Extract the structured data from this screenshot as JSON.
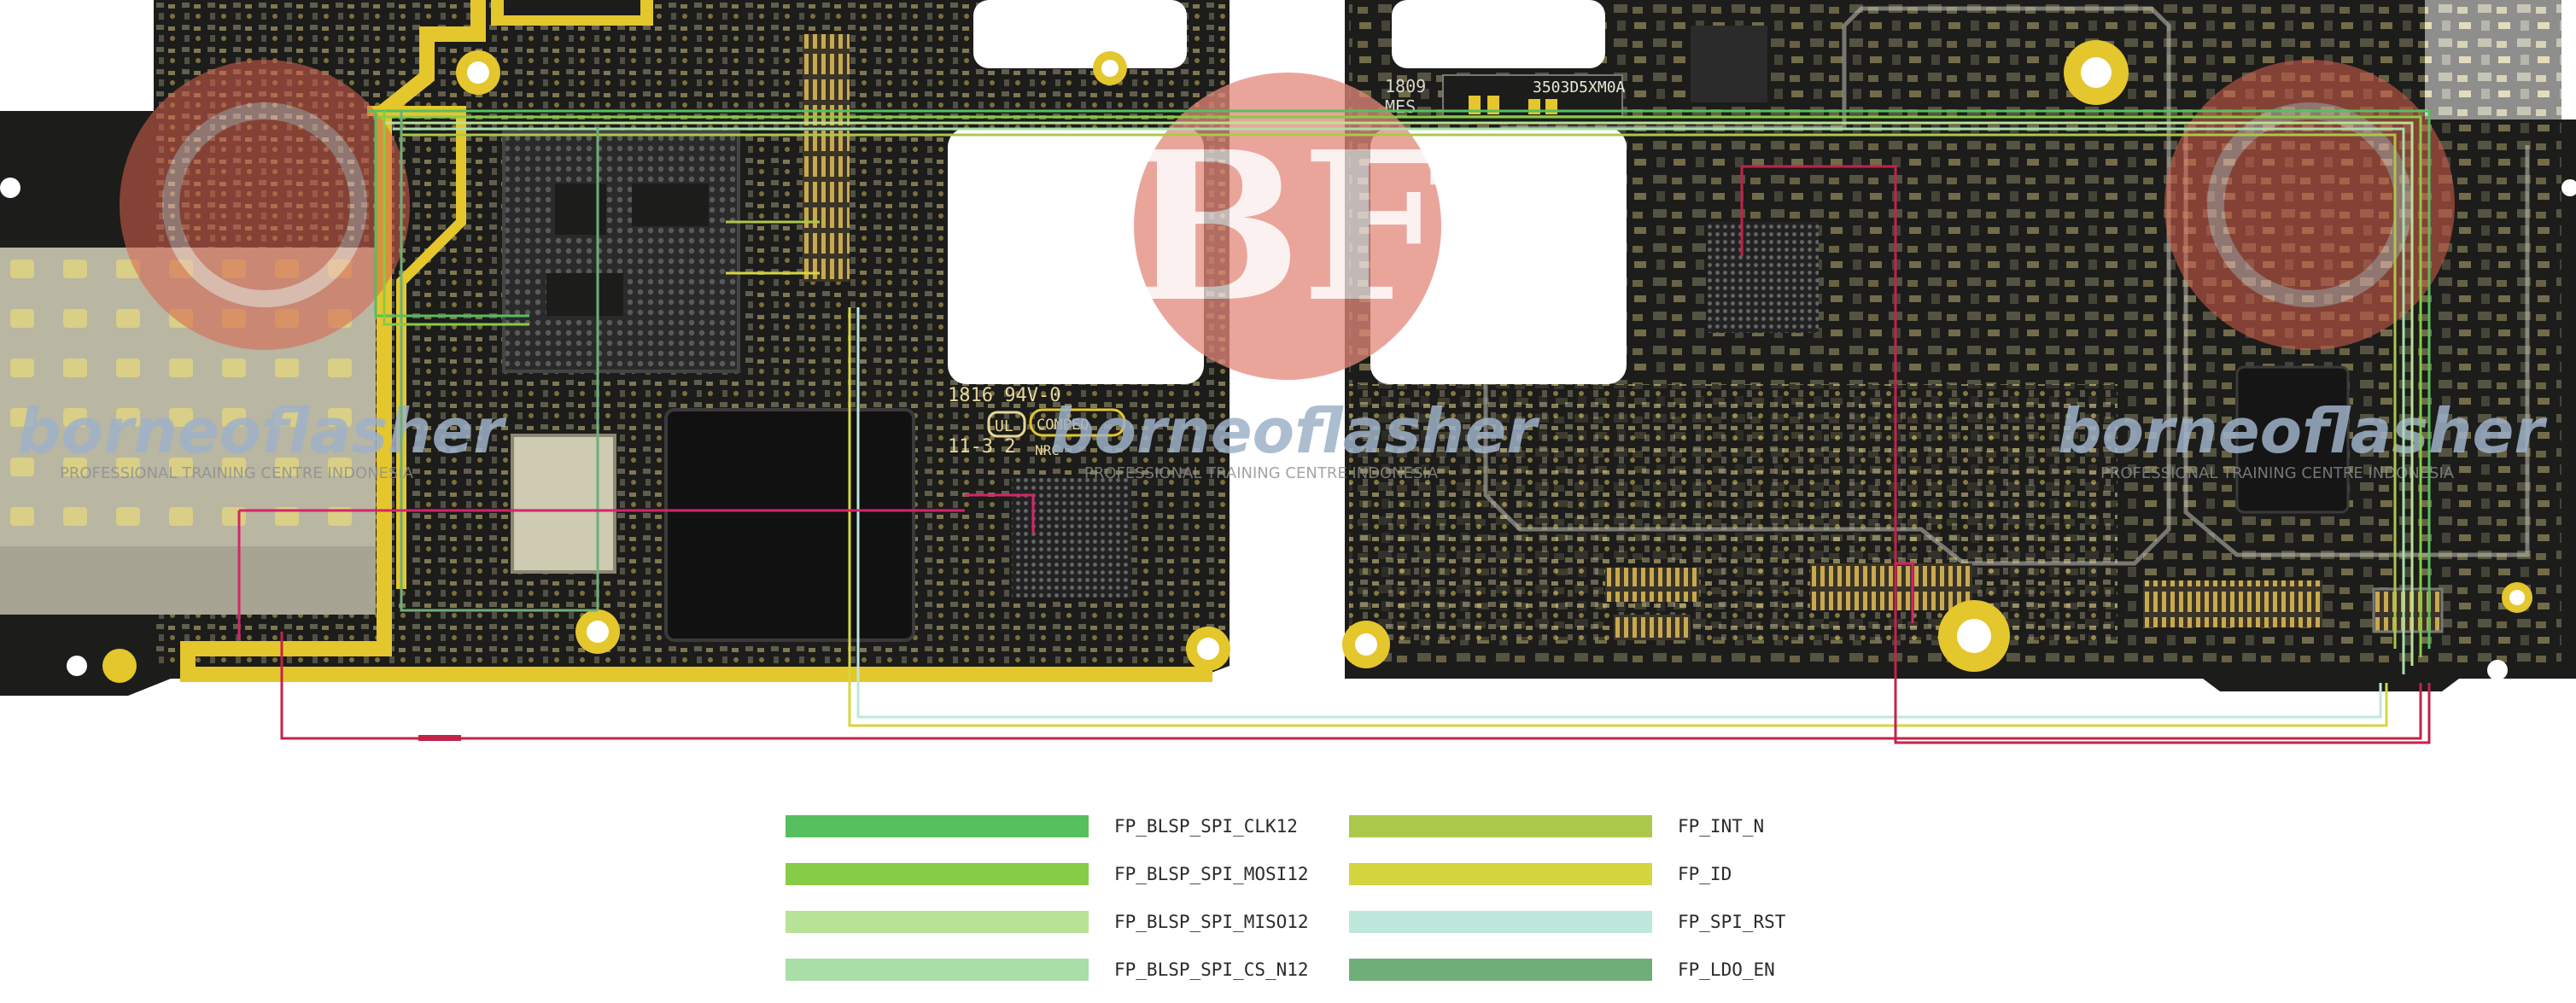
{
  "watermark": {
    "brand": "borneoflasher",
    "tagline": "PROFESSIONAL TRAINING CENTRE INDONESIA",
    "logo_text": "BF"
  },
  "silkscreen": {
    "date_code_line1": "1816 94V-0",
    "date_code_line2": "11-3 2",
    "ul_text": "UL",
    "compeq": "COMPEQ",
    "nrc": "NRC",
    "board_id_left": "1809",
    "board_id_left2": "MES",
    "board_id_right": "3503D5XM0A"
  },
  "legend": {
    "items": [
      {
        "label": "FP_BLSP_SPI_CLK12",
        "color": "#56bf5e"
      },
      {
        "label": "FP_BLSP_SPI_MOSI12",
        "color": "#87cc46"
      },
      {
        "label": "FP_BLSP_SPI_MISO12",
        "color": "#b8e296"
      },
      {
        "label": "FP_BLSP_SPI_CS_N12",
        "color": "#a9dea9"
      },
      {
        "label": "FP_INT_N",
        "color": "#acc84a"
      },
      {
        "label": "FP_ID",
        "color": "#d5d63f"
      },
      {
        "label": "FP_SPI_RST",
        "color": "#bfe8dc"
      },
      {
        "label": "FP_LDO_EN",
        "color": "#6fae79"
      }
    ]
  },
  "trace_colors": {
    "highlight_pink": "#d6246a",
    "highlight_red": "#c2234a",
    "pcb_black": "#1c1c1a",
    "gold": "#e4c62d"
  }
}
